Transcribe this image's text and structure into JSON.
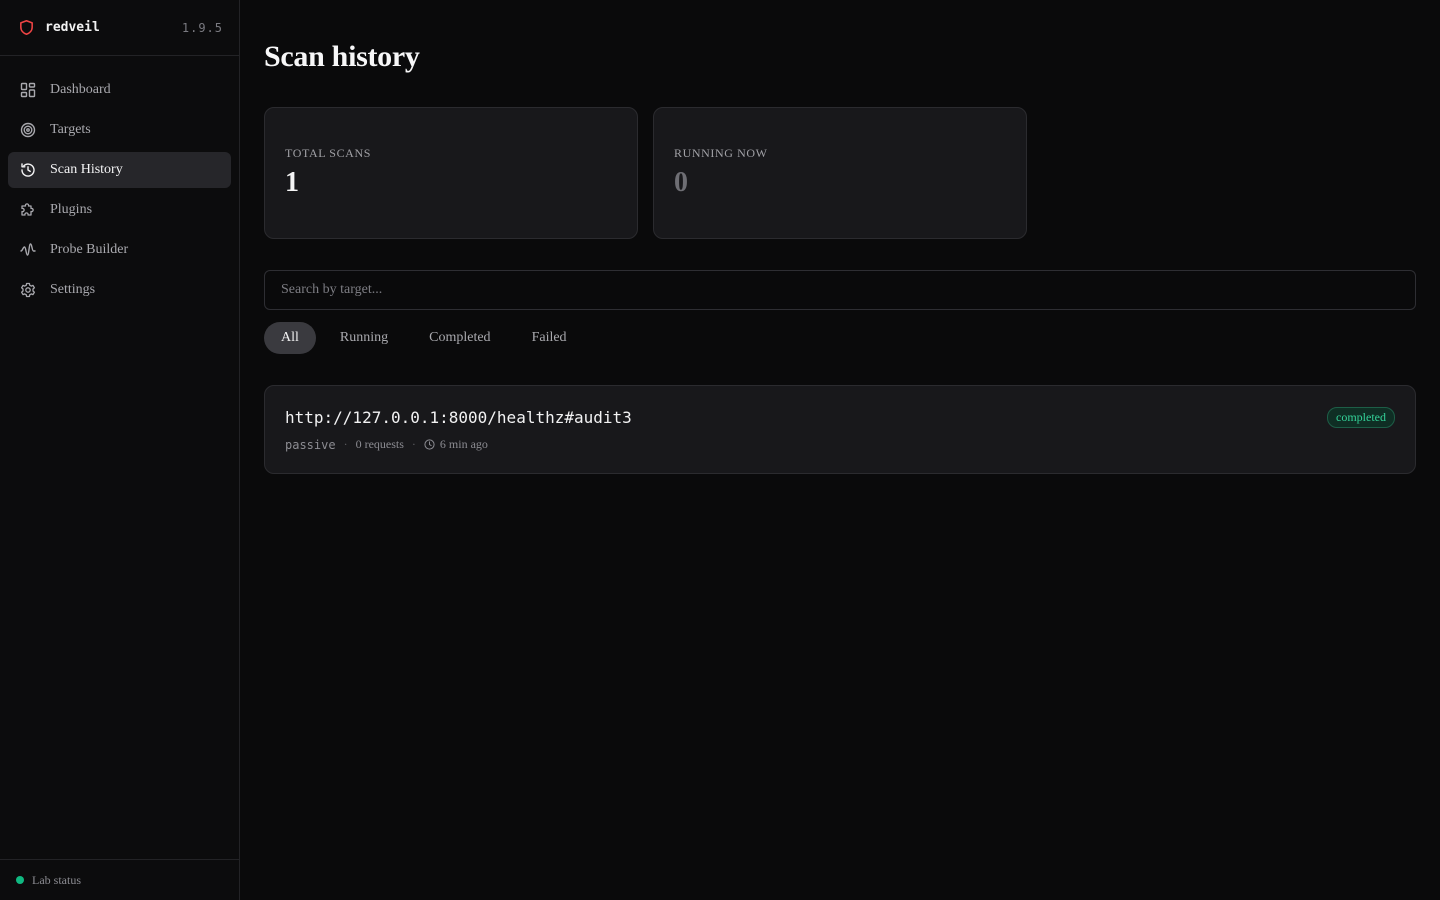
{
  "brand": {
    "name": "redveil",
    "version": "1.9.5",
    "accent": "#ef4444"
  },
  "sidebar": {
    "items": [
      {
        "label": "Dashboard",
        "icon": "dashboard-icon"
      },
      {
        "label": "Targets",
        "icon": "target-icon"
      },
      {
        "label": "Scan History",
        "icon": "history-icon",
        "active": true
      },
      {
        "label": "Plugins",
        "icon": "puzzle-icon"
      },
      {
        "label": "Probe Builder",
        "icon": "waveform-icon"
      },
      {
        "label": "Settings",
        "icon": "gear-icon"
      }
    ],
    "footer": {
      "label": "Lab status",
      "status_color": "#10b981"
    }
  },
  "main": {
    "title": "Scan history",
    "stats": [
      {
        "label": "Total scans",
        "value": "1"
      },
      {
        "label": "Running now",
        "value": "0"
      }
    ],
    "search": {
      "placeholder": "Search by target...",
      "value": ""
    },
    "filters": [
      {
        "label": "All",
        "active": true
      },
      {
        "label": "Running"
      },
      {
        "label": "Completed"
      },
      {
        "label": "Failed"
      }
    ],
    "scans": [
      {
        "target": "http://127.0.0.1:8000/healthz#audit3",
        "mode": "passive",
        "requests": "0 requests",
        "time": "6 min ago",
        "status": "completed",
        "status_color": "#34d399"
      }
    ]
  }
}
